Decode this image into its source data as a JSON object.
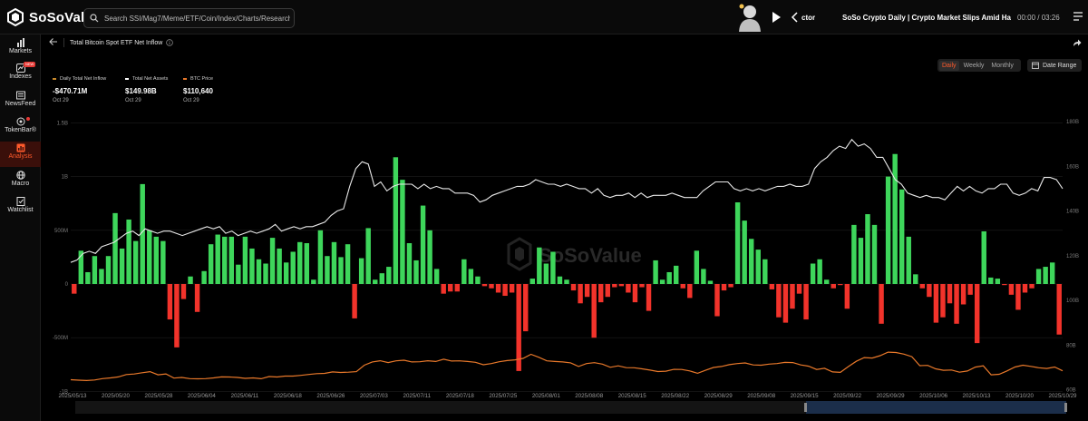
{
  "app": {
    "name": "SoSoValue"
  },
  "search": {
    "placeholder": "Search SSI/Mag7/Meme/ETF/Coin/Index/Charts/Research"
  },
  "podcast": {
    "author": "ctor",
    "title": "SoSo Crypto Daily | Crypto Market Slips Amid Hawkish Fe",
    "time": "00:00 / 03:26"
  },
  "sidebar": {
    "items": [
      {
        "label": "Markets",
        "icon": "chart-bar-icon"
      },
      {
        "label": "Indexes",
        "icon": "index-icon",
        "badge": "NEW"
      },
      {
        "label": "NewsFeed",
        "icon": "news-icon"
      },
      {
        "label": "TokenBar®",
        "icon": "tokenbar-icon",
        "dot": true
      },
      {
        "label": "Analysis",
        "icon": "analysis-icon",
        "active": true
      },
      {
        "label": "Macro",
        "icon": "globe-icon"
      },
      {
        "label": "Watchlist",
        "icon": "watchlist-icon"
      }
    ]
  },
  "page": {
    "title": "Total Bitcoin Spot ETF Net Inflow"
  },
  "controls": {
    "tabs": [
      "Daily",
      "Weekly",
      "Monthly"
    ],
    "active_tab": "Daily",
    "date_range_label": "Date Range"
  },
  "legend": [
    {
      "label": "Daily Total Net Inflow",
      "value": "-$470.71M",
      "date": "Oct 29",
      "color": "#c98a2b"
    },
    {
      "label": "Total Net Assets",
      "value": "$149.98B",
      "date": "Oct 29",
      "color": "#ffffff"
    },
    {
      "label": "BTC Price",
      "value": "$110,640",
      "date": "Oct 29",
      "color": "#e8782a"
    }
  ],
  "watermark": {
    "text": "SoSoValue"
  },
  "colors": {
    "positive": "#3ed65b",
    "negative": "#f2332b",
    "assets_line": "#e8e8e8",
    "btc_line": "#e8782a",
    "accent": "#ff5a2b"
  },
  "chart_data": {
    "type": "bar",
    "title": "Total Bitcoin Spot ETF Net Inflow",
    "x_tick_labels": [
      "2025/05/13",
      "2025/05/20",
      "2025/05/28",
      "2025/06/04",
      "2025/06/11",
      "2025/06/18",
      "2025/06/26",
      "2025/07/03",
      "2025/07/11",
      "2025/07/18",
      "2025/07/25",
      "2025/08/01",
      "2025/08/08",
      "2025/08/15",
      "2025/08/22",
      "2025/08/29",
      "2025/09/08",
      "2025/09/15",
      "2025/09/22",
      "2025/09/29",
      "2025/10/06",
      "2025/10/13",
      "2025/10/20",
      "2025/10/29"
    ],
    "y_left_ticks": [
      "1.5B",
      "1B",
      "500M",
      "0",
      "-500M",
      "-1B"
    ],
    "y_left_range": [
      -1000,
      1500
    ],
    "y_right_ticks": [
      "180B",
      "160B",
      "140B",
      "120B",
      "100B",
      "80B",
      "60B"
    ],
    "y_right_range": [
      60,
      180
    ],
    "grid": true,
    "series": [
      {
        "name": "Daily Total Net Inflow",
        "unit": "M USD",
        "values": [
          -90,
          310,
          110,
          260,
          140,
          260,
          660,
          330,
          600,
          400,
          930,
          500,
          440,
          400,
          -330,
          -590,
          -140,
          70,
          -260,
          120,
          370,
          460,
          440,
          440,
          180,
          440,
          330,
          230,
          190,
          430,
          330,
          200,
          300,
          390,
          380,
          40,
          500,
          260,
          390,
          250,
          370,
          -320,
          240,
          520,
          40,
          100,
          160,
          1180,
          970,
          380,
          220,
          730,
          500,
          140,
          -90,
          -70,
          -70,
          230,
          140,
          70,
          -20,
          -40,
          -80,
          -110,
          -80,
          -810,
          -440,
          50,
          340,
          190,
          300,
          70,
          40,
          -60,
          -180,
          -120,
          -500,
          -170,
          -120,
          -30,
          -20,
          -80,
          -170,
          -30,
          -250,
          220,
          40,
          110,
          170,
          -40,
          -130,
          310,
          140,
          30,
          -300,
          -60,
          -30,
          760,
          590,
          420,
          320,
          230,
          -50,
          -310,
          -360,
          -230,
          -90,
          -330,
          190,
          230,
          40,
          -40,
          -10,
          -230,
          550,
          430,
          650,
          550,
          -370,
          1000,
          1210,
          880,
          440,
          90,
          -40,
          -120,
          -360,
          -310,
          -180,
          -370,
          -190,
          -100,
          -550,
          490,
          60,
          50,
          -10,
          -100,
          -240,
          -80,
          -40,
          140,
          160,
          200,
          -470.71
        ]
      },
      {
        "name": "Total Net Assets",
        "unit": "B USD",
        "values": [
          117,
          118,
          121,
          122,
          121,
          124,
          125,
          126,
          128,
          130,
          131,
          129,
          132,
          131,
          130,
          131,
          131,
          130,
          129,
          130,
          131,
          132,
          133,
          132,
          133,
          130,
          131,
          129,
          130,
          131,
          130,
          131,
          132,
          134,
          131,
          132,
          133,
          132,
          133,
          133,
          134,
          135,
          138,
          140,
          141,
          151,
          159,
          162,
          161,
          151,
          153,
          149,
          151,
          152,
          152,
          152,
          150,
          152,
          150,
          151,
          150,
          150,
          148,
          148,
          148,
          147,
          144,
          145,
          147,
          148,
          149,
          150,
          151,
          151,
          152,
          154,
          153,
          152,
          152,
          151,
          152,
          151,
          150,
          150,
          148,
          150,
          147,
          146,
          147,
          147,
          148,
          146,
          148,
          146,
          147,
          147,
          147,
          148,
          147,
          146,
          146,
          146,
          149,
          151,
          153,
          153,
          153,
          150,
          149,
          150,
          149,
          150,
          149,
          150,
          151,
          151,
          152,
          151,
          151,
          152,
          159,
          162,
          164,
          167,
          169,
          168,
          172,
          169,
          170,
          168,
          164,
          164,
          159,
          154,
          152,
          148,
          147,
          146,
          147,
          146,
          146,
          145,
          148,
          151,
          149,
          151,
          149,
          148,
          150,
          150,
          152,
          152,
          148,
          147,
          148,
          150,
          149,
          155,
          155,
          154,
          149.98
        ]
      },
      {
        "name": "BTC Price",
        "unit": "USD",
        "values": [
          103800,
          103500,
          103200,
          103600,
          104700,
          105200,
          106000,
          107800,
          108200,
          109200,
          110000,
          107600,
          108300,
          105100,
          105600,
          104700,
          104500,
          104700,
          105200,
          106000,
          105900,
          105600,
          104900,
          105200,
          104600,
          106300,
          105900,
          106600,
          106600,
          107200,
          107900,
          108500,
          108700,
          109800,
          109400,
          109600,
          110000,
          115000,
          117500,
          118400,
          117000,
          118300,
          118800,
          117500,
          117600,
          118400,
          117800,
          119600,
          118200,
          118300,
          117800,
          117200,
          115300,
          116200,
          117600,
          118500,
          119100,
          120200,
          123300,
          121000,
          118300,
          117800,
          117500,
          116800,
          114000,
          116200,
          116900,
          115800,
          113400,
          114500,
          113100,
          113000,
          112200,
          111200,
          110100,
          110400,
          111800,
          111700,
          110600,
          108800,
          111100,
          113200,
          114000,
          115400,
          116200,
          116700,
          115200,
          115000,
          115800,
          116200,
          117100,
          117000,
          115200,
          114200,
          111700,
          112600,
          109800,
          109500,
          113900,
          118000,
          120800,
          120500,
          122300,
          125000,
          124700,
          123500,
          121500,
          114600,
          114800,
          112200,
          111100,
          111300,
          109600,
          110500,
          113500,
          114500,
          107600,
          108000,
          110600,
          113600,
          115000,
          114100,
          113000,
          112500,
          113600,
          110640
        ]
      }
    ]
  }
}
